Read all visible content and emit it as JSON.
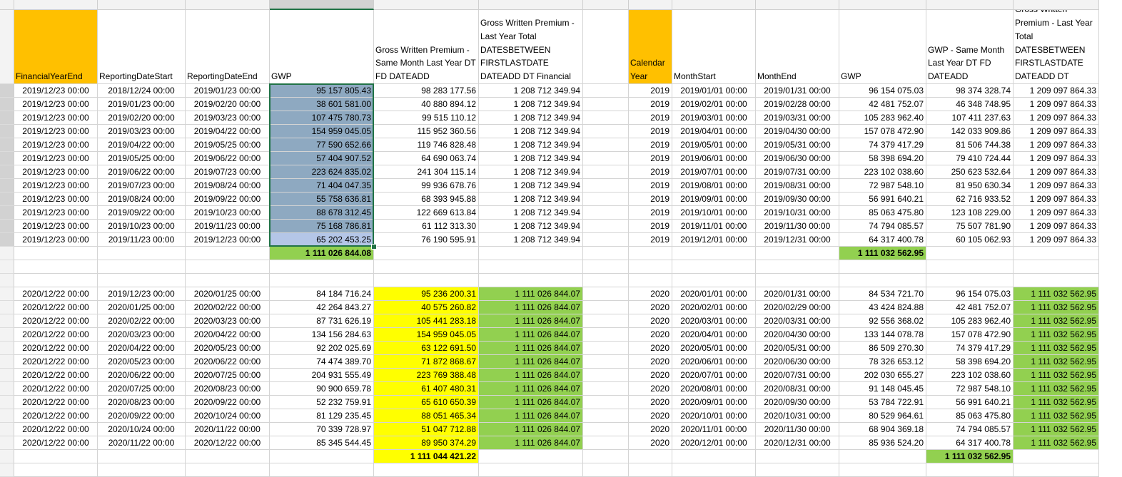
{
  "columns": [
    "A",
    "B",
    "C",
    "D",
    "E",
    "F",
    "G",
    "H",
    "I",
    "J",
    "K",
    "L",
    "M"
  ],
  "rows": [
    {
      "n": "1",
      "cells": {
        "A": "FinancialYearEnd",
        "B": "ReportingDateStart",
        "C": "ReportingDateEnd",
        "D": "GWP",
        "E": "Gross Written Premium - Same Month Last Year DT FD DATEADD",
        "F": "Gross Written Premium - Last Year Total DATESBETWEEN FIRSTLASTDATE DATEADD DT Financial",
        "H": "Calendar Year",
        "I": "MonthStart",
        "J": "MonthEnd",
        "K": "GWP",
        "L": "GWP - Same Month Last Year DT FD DATEADD",
        "M": "Gross Written Premium - Last Year Total DATESBETWEEN FIRSTLASTDATE DATEADD DT"
      }
    },
    {
      "n": "2",
      "cells": {
        "A": "2019/12/23 00:00",
        "B": "2018/12/24 00:00",
        "C": "2019/01/23 00:00",
        "D": "95 157 805.43",
        "E": "98 283 177.56",
        "F": "1 208 712 349.94",
        "H": "2019",
        "I": "2019/01/01 00:00",
        "J": "2019/01/31 00:00",
        "K": "96 154 075.03",
        "L": "98 374 328.74",
        "M": "1 209 097 864.33"
      }
    },
    {
      "n": "3",
      "cells": {
        "A": "2019/12/23 00:00",
        "B": "2019/01/23 00:00",
        "C": "2019/02/20 00:00",
        "D": "38 601 581.00",
        "E": "40 880 894.12",
        "F": "1 208 712 349.94",
        "H": "2019",
        "I": "2019/02/01 00:00",
        "J": "2019/02/28 00:00",
        "K": "42 481 752.07",
        "L": "46 348 748.95",
        "M": "1 209 097 864.33"
      }
    },
    {
      "n": "4",
      "cells": {
        "A": "2019/12/23 00:00",
        "B": "2019/02/20 00:00",
        "C": "2019/03/23 00:00",
        "D": "107 475 780.73",
        "E": "99 515 110.12",
        "F": "1 208 712 349.94",
        "H": "2019",
        "I": "2019/03/01 00:00",
        "J": "2019/03/31 00:00",
        "K": "105 283 962.40",
        "L": "107 411 237.63",
        "M": "1 209 097 864.33"
      }
    },
    {
      "n": "5",
      "cells": {
        "A": "2019/12/23 00:00",
        "B": "2019/03/23 00:00",
        "C": "2019/04/22 00:00",
        "D": "154 959 045.05",
        "E": "115 952 360.56",
        "F": "1 208 712 349.94",
        "H": "2019",
        "I": "2019/04/01 00:00",
        "J": "2019/04/30 00:00",
        "K": "157 078 472.90",
        "L": "142 033 909.86",
        "M": "1 209 097 864.33"
      }
    },
    {
      "n": "6",
      "cells": {
        "A": "2019/12/23 00:00",
        "B": "2019/04/22 00:00",
        "C": "2019/05/25 00:00",
        "D": "77 590 652.66",
        "E": "119 746 828.48",
        "F": "1 208 712 349.94",
        "H": "2019",
        "I": "2019/05/01 00:00",
        "J": "2019/05/31 00:00",
        "K": "74 379 417.29",
        "L": "81 506 744.38",
        "M": "1 209 097 864.33"
      }
    },
    {
      "n": "7",
      "cells": {
        "A": "2019/12/23 00:00",
        "B": "2019/05/25 00:00",
        "C": "2019/06/22 00:00",
        "D": "57 404 907.52",
        "E": "64 690 063.74",
        "F": "1 208 712 349.94",
        "H": "2019",
        "I": "2019/06/01 00:00",
        "J": "2019/06/30 00:00",
        "K": "58 398 694.20",
        "L": "79 410 724.44",
        "M": "1 209 097 864.33"
      }
    },
    {
      "n": "8",
      "cells": {
        "A": "2019/12/23 00:00",
        "B": "2019/06/22 00:00",
        "C": "2019/07/23 00:00",
        "D": "223 624 835.02",
        "E": "241 304 115.14",
        "F": "1 208 712 349.94",
        "H": "2019",
        "I": "2019/07/01 00:00",
        "J": "2019/07/31 00:00",
        "K": "223 102 038.60",
        "L": "250 623 532.64",
        "M": "1 209 097 864.33"
      }
    },
    {
      "n": "9",
      "cells": {
        "A": "2019/12/23 00:00",
        "B": "2019/07/23 00:00",
        "C": "2019/08/24 00:00",
        "D": "71 404 047.35",
        "E": "99 936 678.76",
        "F": "1 208 712 349.94",
        "H": "2019",
        "I": "2019/08/01 00:00",
        "J": "2019/08/31 00:00",
        "K": "72 987 548.10",
        "L": "81 950 630.34",
        "M": "1 209 097 864.33"
      }
    },
    {
      "n": "10",
      "cells": {
        "A": "2019/12/23 00:00",
        "B": "2019/08/24 00:00",
        "C": "2019/09/22 00:00",
        "D": "55 758 636.81",
        "E": "68 393 945.88",
        "F": "1 208 712 349.94",
        "H": "2019",
        "I": "2019/09/01 00:00",
        "J": "2019/09/30 00:00",
        "K": "56 991 640.21",
        "L": "62 716 933.52",
        "M": "1 209 097 864.33"
      }
    },
    {
      "n": "11",
      "cells": {
        "A": "2019/12/23 00:00",
        "B": "2019/09/22 00:00",
        "C": "2019/10/23 00:00",
        "D": "88 678 312.45",
        "E": "122 669 613.84",
        "F": "1 208 712 349.94",
        "H": "2019",
        "I": "2019/10/01 00:00",
        "J": "2019/10/31 00:00",
        "K": "85 063 475.80",
        "L": "123 108 229.00",
        "M": "1 209 097 864.33"
      }
    },
    {
      "n": "12",
      "cells": {
        "A": "2019/12/23 00:00",
        "B": "2019/10/23 00:00",
        "C": "2019/11/23 00:00",
        "D": "75 168 786.81",
        "E": "61 112 313.30",
        "F": "1 208 712 349.94",
        "H": "2019",
        "I": "2019/11/01 00:00",
        "J": "2019/11/30 00:00",
        "K": "74 794 085.57",
        "L": "75 507 781.90",
        "M": "1 209 097 864.33"
      }
    },
    {
      "n": "13",
      "cells": {
        "A": "2019/12/23 00:00",
        "B": "2019/11/23 00:00",
        "C": "2019/12/23 00:00",
        "D": "65 202 453.25",
        "E": "76 190 595.91",
        "F": "1 208 712 349.94",
        "H": "2019",
        "I": "2019/12/01 00:00",
        "J": "2019/12/31 00:00",
        "K": "64 317 400.78",
        "L": "60 105 062.93",
        "M": "1 209 097 864.33"
      }
    },
    {
      "n": "14",
      "cells": {
        "D": "1 111 026 844.08",
        "K": "1 111 032 562.95"
      }
    },
    {
      "n": "15",
      "cells": {}
    },
    {
      "n": "16",
      "cells": {}
    },
    {
      "n": "17",
      "cells": {
        "A": "2020/12/22 00:00",
        "B": "2019/12/23 00:00",
        "C": "2020/01/25 00:00",
        "D": "84 184 716.24",
        "E": "95 236 200.31",
        "F": "1 111 026 844.07",
        "H": "2020",
        "I": "2020/01/01 00:00",
        "J": "2020/01/31 00:00",
        "K": "84 534 721.70",
        "L": "96 154 075.03",
        "M": "1 111 032 562.95"
      }
    },
    {
      "n": "18",
      "cells": {
        "A": "2020/12/22 00:00",
        "B": "2020/01/25 00:00",
        "C": "2020/02/22 00:00",
        "D": "42 264 843.27",
        "E": "40 575 260.82",
        "F": "1 111 026 844.07",
        "H": "2020",
        "I": "2020/02/01 00:00",
        "J": "2020/02/29 00:00",
        "K": "43 424 824.88",
        "L": "42 481 752.07",
        "M": "1 111 032 562.95"
      }
    },
    {
      "n": "19",
      "cells": {
        "A": "2020/12/22 00:00",
        "B": "2020/02/22 00:00",
        "C": "2020/03/23 00:00",
        "D": "87 731 626.19",
        "E": "105 441 283.18",
        "F": "1 111 026 844.07",
        "H": "2020",
        "I": "2020/03/01 00:00",
        "J": "2020/03/31 00:00",
        "K": "92 556 368.02",
        "L": "105 283 962.40",
        "M": "1 111 032 562.95"
      }
    },
    {
      "n": "20",
      "cells": {
        "A": "2020/12/22 00:00",
        "B": "2020/03/23 00:00",
        "C": "2020/04/22 00:00",
        "D": "134 156 284.63",
        "E": "154 959 045.05",
        "F": "1 111 026 844.07",
        "H": "2020",
        "I": "2020/04/01 00:00",
        "J": "2020/04/30 00:00",
        "K": "133 144 078.78",
        "L": "157 078 472.90",
        "M": "1 111 032 562.95"
      }
    },
    {
      "n": "21",
      "cells": {
        "A": "2020/12/22 00:00",
        "B": "2020/04/22 00:00",
        "C": "2020/05/23 00:00",
        "D": "92 202 025.69",
        "E": "63 122 691.50",
        "F": "1 111 026 844.07",
        "H": "2020",
        "I": "2020/05/01 00:00",
        "J": "2020/05/31 00:00",
        "K": "86 509 270.30",
        "L": "74 379 417.29",
        "M": "1 111 032 562.95"
      }
    },
    {
      "n": "22",
      "cells": {
        "A": "2020/12/22 00:00",
        "B": "2020/05/23 00:00",
        "C": "2020/06/22 00:00",
        "D": "74 474 389.70",
        "E": "71 872 868.67",
        "F": "1 111 026 844.07",
        "H": "2020",
        "I": "2020/06/01 00:00",
        "J": "2020/06/30 00:00",
        "K": "78 326 653.12",
        "L": "58 398 694.20",
        "M": "1 111 032 562.95"
      }
    },
    {
      "n": "23",
      "cells": {
        "A": "2020/12/22 00:00",
        "B": "2020/06/22 00:00",
        "C": "2020/07/25 00:00",
        "D": "204 931 555.49",
        "E": "223 769 388.48",
        "F": "1 111 026 844.07",
        "H": "2020",
        "I": "2020/07/01 00:00",
        "J": "2020/07/31 00:00",
        "K": "202 030 655.27",
        "L": "223 102 038.60",
        "M": "1 111 032 562.95"
      }
    },
    {
      "n": "24",
      "cells": {
        "A": "2020/12/22 00:00",
        "B": "2020/07/25 00:00",
        "C": "2020/08/23 00:00",
        "D": "90 900 659.78",
        "E": "61 407 480.31",
        "F": "1 111 026 844.07",
        "H": "2020",
        "I": "2020/08/01 00:00",
        "J": "2020/08/31 00:00",
        "K": "91 148 045.45",
        "L": "72 987 548.10",
        "M": "1 111 032 562.95"
      }
    },
    {
      "n": "25",
      "cells": {
        "A": "2020/12/22 00:00",
        "B": "2020/08/23 00:00",
        "C": "2020/09/22 00:00",
        "D": "52 232 759.91",
        "E": "65 610 650.39",
        "F": "1 111 026 844.07",
        "H": "2020",
        "I": "2020/09/01 00:00",
        "J": "2020/09/30 00:00",
        "K": "53 784 722.91",
        "L": "56 991 640.21",
        "M": "1 111 032 562.95"
      }
    },
    {
      "n": "26",
      "cells": {
        "A": "2020/12/22 00:00",
        "B": "2020/09/22 00:00",
        "C": "2020/10/24 00:00",
        "D": "81 129 235.45",
        "E": "88 051 465.34",
        "F": "1 111 026 844.07",
        "H": "2020",
        "I": "2020/10/01 00:00",
        "J": "2020/10/31 00:00",
        "K": "80 529 964.61",
        "L": "85 063 475.80",
        "M": "1 111 032 562.95"
      }
    },
    {
      "n": "27",
      "cells": {
        "A": "2020/12/22 00:00",
        "B": "2020/10/24 00:00",
        "C": "2020/11/22 00:00",
        "D": "70 339 728.97",
        "E": "51 047 712.88",
        "F": "1 111 026 844.07",
        "H": "2020",
        "I": "2020/11/01 00:00",
        "J": "2020/11/30 00:00",
        "K": "68 904 369.18",
        "L": "74 794 085.57",
        "M": "1 111 032 562.95"
      }
    },
    {
      "n": "28",
      "cells": {
        "A": "2020/12/22 00:00",
        "B": "2020/11/22 00:00",
        "C": "2020/12/22 00:00",
        "D": "85 345 544.45",
        "E": "89 950 374.29",
        "F": "1 111 026 844.07",
        "H": "2020",
        "I": "2020/12/01 00:00",
        "J": "2020/12/31 00:00",
        "K": "85 936 524.20",
        "L": "64 317 400.78",
        "M": "1 111 032 562.95"
      }
    },
    {
      "n": "29",
      "cells": {
        "E": "1 111 044 421.22",
        "L": "1 111 032 562.95"
      }
    },
    {
      "n": "30",
      "cells": {}
    }
  ],
  "highlights": {
    "orange": "#ffc000",
    "yellow": "#ffff00",
    "green": "#92d050",
    "selection": "#8ea9c1",
    "selection_active": "#b4c6e7",
    "excel_green": "#217346"
  },
  "selection": {
    "range": "D2:D13",
    "active_cell": "D13"
  }
}
